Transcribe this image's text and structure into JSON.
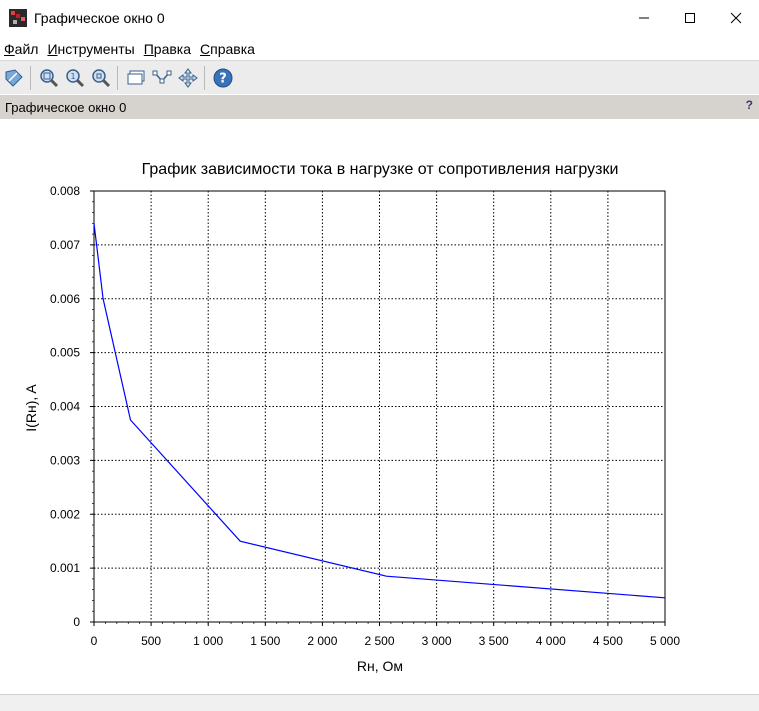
{
  "window": {
    "title": "Графическое окно 0",
    "icon": "scilab-graphics-icon"
  },
  "menu": [
    {
      "label": "Файл",
      "accel": "Ф",
      "rest": "айл"
    },
    {
      "label": "Инструменты",
      "accel": "И",
      "rest": "нструменты"
    },
    {
      "label": "Правка",
      "accel": "П",
      "rest": "равка"
    },
    {
      "label": "Справка",
      "accel": "С",
      "rest": "правка"
    }
  ],
  "toolbar": {
    "icons": [
      "rotate-icon",
      "zoom-area-icon",
      "zoom-original-icon",
      "zoom-out-icon",
      "datatip-icon",
      "edit-curve-icon",
      "pan-icon",
      "help-icon"
    ]
  },
  "tab": {
    "label": "Графическое окно 0",
    "help": "?"
  },
  "colors": {
    "line": "#0000ff",
    "grid": "#000000",
    "tabbar": "#d6d3cf",
    "toolbar": "#ececec"
  },
  "chart_data": {
    "type": "line",
    "title": "График зависимости тока в нагрузке от сопротивления нагрузки",
    "xlabel": "Rн, Ом",
    "ylabel": "I(Rн), A",
    "xlim": [
      0,
      5000
    ],
    "ylim": [
      0,
      0.008
    ],
    "grid": true,
    "xticks": [
      0,
      500,
      1000,
      1500,
      2000,
      2500,
      3000,
      3500,
      4000,
      4500,
      5000
    ],
    "xtick_labels": [
      "0",
      "500",
      "1 000",
      "1 500",
      "2 000",
      "2 500",
      "3 000",
      "3 500",
      "4 000",
      "4 500",
      "5 000"
    ],
    "yticks": [
      0,
      0.001,
      0.002,
      0.003,
      0.004,
      0.005,
      0.006,
      0.007,
      0.008
    ],
    "ytick_labels": [
      "0",
      "0.001",
      "0.002",
      "0.003",
      "0.004",
      "0.005",
      "0.006",
      "0.007",
      "0.008"
    ],
    "series": [
      {
        "x": [
          0,
          80,
          320,
          1280,
          2560,
          5000
        ],
        "y": [
          0.0074,
          0.006,
          0.00375,
          0.0015,
          0.00085,
          0.00045
        ]
      }
    ]
  }
}
